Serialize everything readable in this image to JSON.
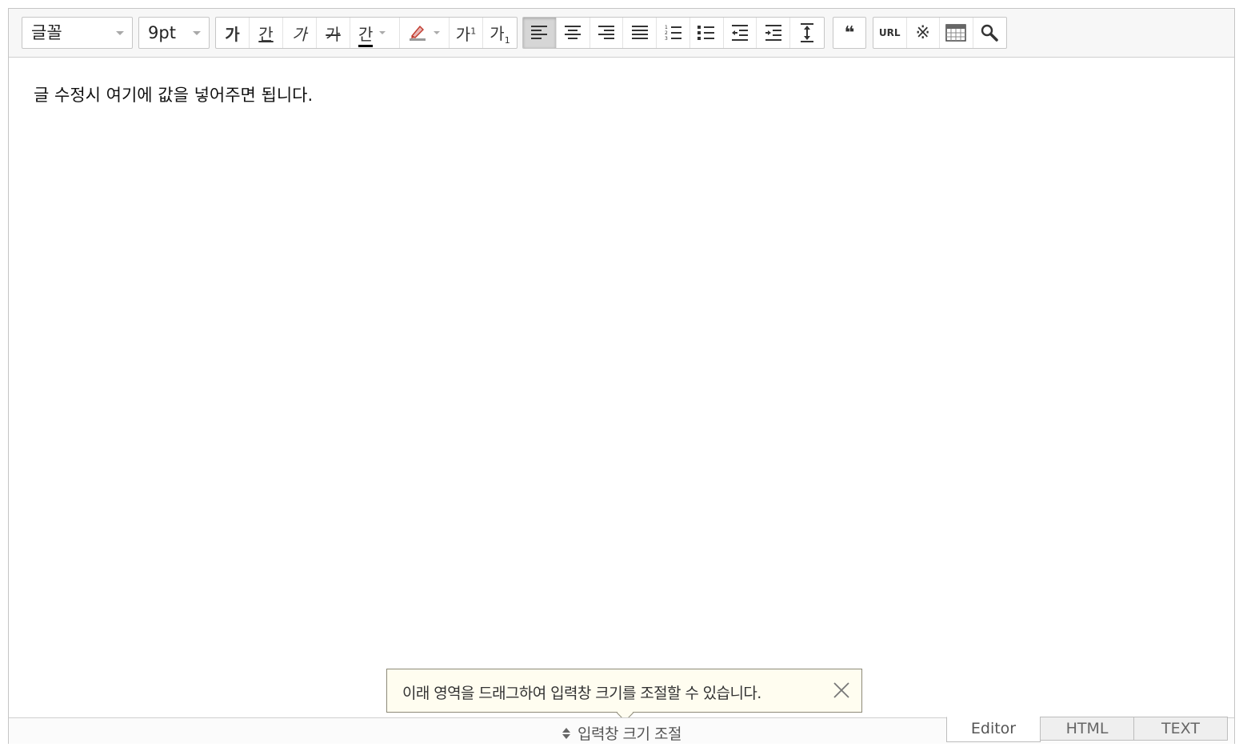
{
  "toolbar": {
    "font_select": "글꼴",
    "size_select": "9pt",
    "format_buttons": [
      {
        "name": "bold",
        "label": "가"
      },
      {
        "name": "underline",
        "label": "간"
      },
      {
        "name": "italic",
        "label": "가"
      },
      {
        "name": "strikethrough",
        "label": "가"
      },
      {
        "name": "font-color",
        "label": "간"
      },
      {
        "name": "highlight-color",
        "icon": "highlighter-icon"
      },
      {
        "name": "superscript",
        "label": "가"
      },
      {
        "name": "subscript",
        "label": "가"
      }
    ],
    "superscript_mark": "1",
    "subscript_mark": "1",
    "align_buttons": [
      "align-left-icon",
      "align-center-icon",
      "align-right-icon",
      "align-justify-icon",
      "ordered-list-icon",
      "bullet-list-icon",
      "outdent-icon",
      "indent-icon",
      "line-height-icon"
    ],
    "quote_label": "❝",
    "url_label": "URL",
    "special_char_label": "※",
    "table_icon": "table-icon",
    "search_icon": "search-icon",
    "accent_color": "#c0392b"
  },
  "content": {
    "text": "글 수정시 여기에 값을 넣어주면 됩니다."
  },
  "tooltip": {
    "message": "이래 영역을 드래그하여 입력창 크기를 조절할 수 있습니다."
  },
  "statusbar": {
    "resize_label": "입력창 크기 조절",
    "tabs": [
      "Editor",
      "HTML",
      "TEXT"
    ]
  }
}
